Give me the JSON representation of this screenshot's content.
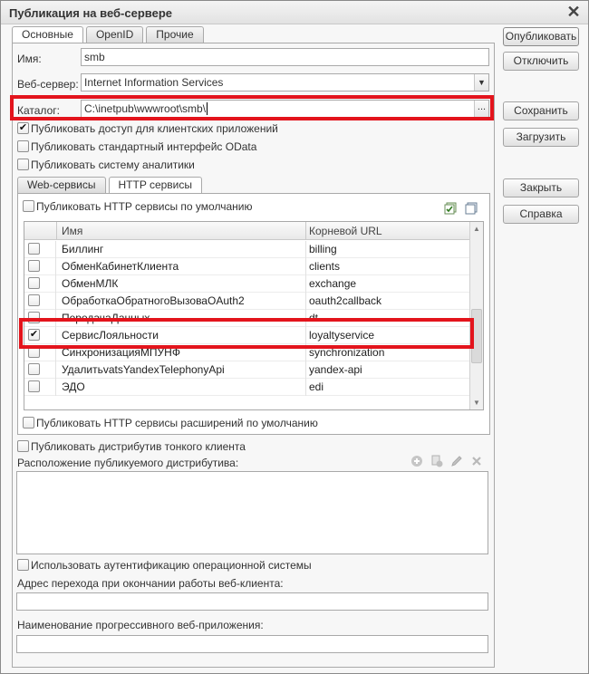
{
  "window": {
    "title": "Публикация на веб-сервере",
    "close_label": "✕"
  },
  "tabs": [
    "Основные",
    "OpenID",
    "Прочие"
  ],
  "form": {
    "name_label": "Имя:",
    "name_value": "smb",
    "webserver_label": "Веб-сервер:",
    "webserver_value": "Internet Information Services",
    "catalog_label": "Каталог:",
    "catalog_value": "C:\\inetpub\\wwwroot\\smb\\",
    "dots_label": "...",
    "dd_label": "▼"
  },
  "checks": {
    "publish_client_apps": {
      "label": "Публиковать доступ для клиентских приложений",
      "checked": true
    },
    "publish_odata": {
      "label": "Публиковать стандартный интерфейс OData",
      "checked": false
    },
    "publish_analytics": {
      "label": "Публиковать систему аналитики",
      "checked": false
    }
  },
  "subtabs": [
    "Web-сервисы",
    "HTTP сервисы"
  ],
  "http": {
    "default_label": "Публиковать HTTP сервисы по умолчанию",
    "columns": {
      "name": "Имя",
      "url": "Корневой URL"
    },
    "rows": [
      {
        "name": "Биллинг",
        "url": "billing",
        "checked": false
      },
      {
        "name": "ОбменКабинетКлиента",
        "url": "clients",
        "checked": false
      },
      {
        "name": "ОбменМЛК",
        "url": "exchange",
        "checked": false
      },
      {
        "name": "ОбработкаОбратногоВызоваOAuth2",
        "url": "oauth2callback",
        "checked": false
      },
      {
        "name": "ПередачаДанных",
        "url": "dt",
        "checked": false
      },
      {
        "name": "СервисЛояльности",
        "url": "loyaltyservice",
        "checked": true
      },
      {
        "name": "СинхронизацияМПУНФ",
        "url": "synchronization",
        "checked": false
      },
      {
        "name": "УдалитьvatsYandexTelephonyApi",
        "url": "yandex-api",
        "checked": false
      },
      {
        "name": "ЭДО",
        "url": "edi",
        "checked": false
      }
    ],
    "extensions_label": "Публиковать HTTP сервисы расширений по умолчанию"
  },
  "distrib": {
    "publish_label": "Публиковать дистрибутив тонкого клиента",
    "location_label": "Расположение публикуемого дистрибутива:"
  },
  "auth": {
    "label": "Использовать аутентификацию операционной системы"
  },
  "redirect": {
    "label": "Адрес перехода при окончании работы веб-клиента:",
    "value": ""
  },
  "pwa": {
    "label": "Наименование прогрессивного веб-приложения:",
    "value": ""
  },
  "buttons": {
    "publish": "Опубликовать",
    "disable": "Отключить",
    "save": "Сохранить",
    "load": "Загрузить",
    "close": "Закрыть",
    "help": "Справка"
  },
  "icons": {
    "check_all": "check-all-icon",
    "uncheck_all": "uncheck-all-icon",
    "add": "add-icon",
    "copy": "copy-icon",
    "edit": "edit-icon",
    "delete": "delete-icon"
  },
  "colors": {
    "highlight": "#e3141c",
    "window_bg": "#f7f7f7",
    "border": "#a9a9a9"
  }
}
